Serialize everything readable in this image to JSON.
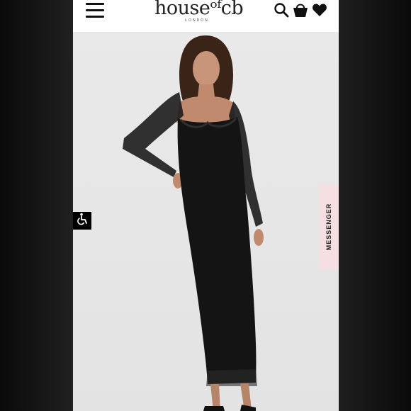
{
  "brand": {
    "logo_text": "house of cb",
    "logo_display": "houseᵒᶠcb",
    "tagline": "LONDON"
  },
  "header": {
    "menu_icon": "hamburger-menu-icon",
    "search_icon": "search-icon",
    "bag_icon": "shopping-bag-icon",
    "wishlist_icon": "heart-icon"
  },
  "product_image": {
    "subject": "model wearing black sheer long-sleeve mesh maxi dress"
  },
  "widgets": {
    "accessibility_icon": "wheelchair-accessibility-icon",
    "messenger_label": "MESSENGER"
  },
  "colors": {
    "header_bg": "#ffffff",
    "photo_bg": "#ebebeb",
    "messenger_bg": "#f6dfe2",
    "accent": "#000000"
  }
}
